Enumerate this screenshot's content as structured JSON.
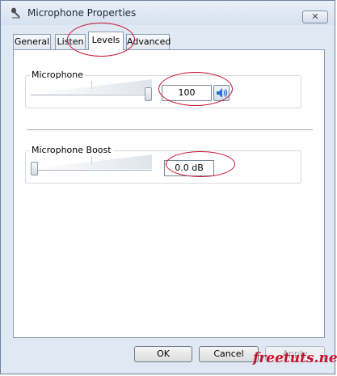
{
  "window": {
    "title": "Microphone Properties",
    "close_label": "✕"
  },
  "tabs": [
    {
      "label": "General",
      "active": false
    },
    {
      "label": "Listen",
      "active": false
    },
    {
      "label": "Levels",
      "active": true
    },
    {
      "label": "Advanced",
      "active": false
    }
  ],
  "microphone": {
    "label": "Microphone",
    "value": "100",
    "level_fraction": 1.0
  },
  "boost": {
    "label": "Microphone Boost",
    "value": "0.0 dB",
    "level_fraction": 0.0
  },
  "buttons": {
    "ok": "OK",
    "cancel": "Cancel",
    "apply": "Apply"
  },
  "watermark": "freetuts.net",
  "colors": {
    "annotation": "#c8102e",
    "speaker": "#2a6fd6"
  }
}
